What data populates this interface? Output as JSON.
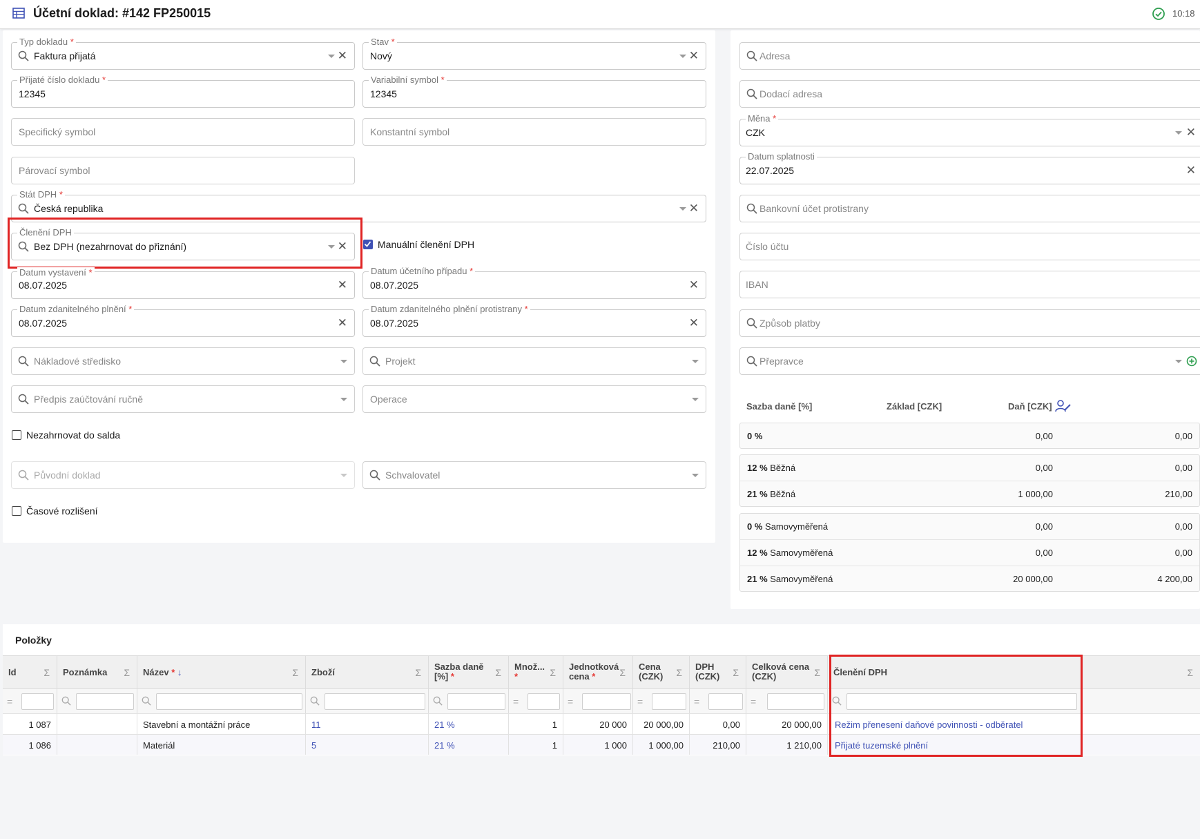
{
  "header": {
    "title": "Účetní doklad: #142 FP250015",
    "time": "10:18"
  },
  "form": {
    "typ_dokladu": {
      "label": "Typ dokladu",
      "value": "Faktura přijatá"
    },
    "stav": {
      "label": "Stav",
      "value": "Nový"
    },
    "prijate_cislo": {
      "label": "Přijaté číslo dokladu",
      "value": "12345"
    },
    "variabilni": {
      "label": "Variabilní symbol",
      "value": "12345"
    },
    "specificky": {
      "placeholder": "Specifický symbol"
    },
    "konstantni": {
      "placeholder": "Konstantní symbol"
    },
    "parovaci": {
      "placeholder": "Párovací symbol"
    },
    "stat_dph": {
      "label": "Stát DPH",
      "value": "Česká republika"
    },
    "cleneni_dph": {
      "label": "Členění DPH",
      "value": "Bez DPH (nezahrnovat do přiznání)"
    },
    "manualni": {
      "label": "Manuální členění DPH",
      "checked": true
    },
    "datum_vystaveni": {
      "label": "Datum vystavení",
      "value": "08.07.2025"
    },
    "datum_ucetniho": {
      "label": "Datum účetního případu",
      "value": "08.07.2025"
    },
    "datum_zdanitelneho": {
      "label": "Datum zdanitelného plnění",
      "value": "08.07.2025"
    },
    "datum_zdanitelneho_proti": {
      "label": "Datum zdanitelného plnění protistrany",
      "value": "08.07.2025"
    },
    "nakladove": {
      "placeholder": "Nákladové středisko"
    },
    "projekt": {
      "placeholder": "Projekt"
    },
    "predpis": {
      "placeholder": "Předpis zaúčtování ručně"
    },
    "operace": {
      "placeholder": "Operace"
    },
    "nezahrnovat": {
      "label": "Nezahrnovat do salda",
      "checked": false
    },
    "puvodni": {
      "placeholder": "Původní doklad"
    },
    "schvalovatel": {
      "placeholder": "Schvalovatel"
    },
    "casove": {
      "label": "Časové rozlišení",
      "checked": false
    }
  },
  "right": {
    "adresa": {
      "placeholder": "Adresa"
    },
    "dodaci": {
      "placeholder": "Dodací adresa"
    },
    "mena": {
      "label": "Měna",
      "value": "CZK"
    },
    "splatnost": {
      "label": "Datum splatnosti",
      "value": "22.07.2025"
    },
    "bankovni": {
      "placeholder": "Bankovní účet protistrany"
    },
    "cislo_uctu": {
      "placeholder": "Číslo účtu"
    },
    "iban": {
      "placeholder": "IBAN"
    },
    "zpusob": {
      "placeholder": "Způsob platby"
    },
    "prepravce": {
      "placeholder": "Přepravce"
    }
  },
  "vat": {
    "headers": {
      "rate": "Sazba daně [%]",
      "base": "Základ [CZK]",
      "tax": "Daň [CZK]"
    },
    "groups": [
      [
        {
          "rate": "0 %",
          "kind": "",
          "base": "0,00",
          "tax": "0,00"
        }
      ],
      [
        {
          "rate": "12 %",
          "kind": "Běžná",
          "base": "0,00",
          "tax": "0,00"
        },
        {
          "rate": "21 %",
          "kind": "Běžná",
          "base": "1 000,00",
          "tax": "210,00"
        }
      ],
      [
        {
          "rate": "0 %",
          "kind": "Samovyměřená",
          "base": "0,00",
          "tax": "0,00"
        },
        {
          "rate": "12 %",
          "kind": "Samovyměřená",
          "base": "0,00",
          "tax": "0,00"
        },
        {
          "rate": "21 %",
          "kind": "Samovyměřená",
          "base": "20 000,00",
          "tax": "4 200,00"
        }
      ]
    ]
  },
  "items": {
    "title": "Položky",
    "columns": {
      "id": "Id",
      "poznamka": "Poznámka",
      "nazev": "Název",
      "zbozi": "Zboží",
      "sazba_1": "Sazba daně",
      "sazba_2": "[%]",
      "mnoz": "Množ...",
      "jedn_1": "Jednotková",
      "jedn_2": "cena",
      "cena_1": "Cena",
      "cena_2": "(CZK)",
      "dph_1": "DPH",
      "dph_2": "(CZK)",
      "celk_1": "Celková cena",
      "celk_2": "(CZK)",
      "cleneni": "Členění DPH"
    },
    "rows": [
      {
        "id": "1 087",
        "poznamka": "",
        "nazev": "Stavební a montážní práce",
        "zbozi": "11",
        "sazba": "21 %",
        "mnoz": "1",
        "jedn": "20 000",
        "cena": "20 000,00",
        "dph": "0,00",
        "celk": "20 000,00",
        "cleneni": "Režim přenesení daňové povinnosti - odběratel"
      },
      {
        "id": "1 086",
        "poznamka": "",
        "nazev": "Materiál",
        "zbozi": "5",
        "sazba": "21 %",
        "mnoz": "1",
        "jedn": "1 000",
        "cena": "1 000,00",
        "dph": "210,00",
        "celk": "1 210,00",
        "cleneni": "Přijaté tuzemské plnění"
      }
    ]
  }
}
